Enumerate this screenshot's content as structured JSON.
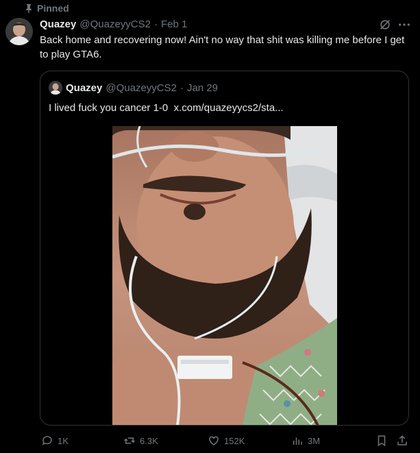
{
  "pinned": {
    "label": "Pinned"
  },
  "tweet": {
    "author_name": "Quazey",
    "handle": "@QuazeyyCS2",
    "separator": "·",
    "date": "Feb 1",
    "text": "Back home and recovering now! Ain't no way that shit was killing me before I get to play GTA6."
  },
  "quoted": {
    "author_name": "Quazey",
    "handle": "@QuazeyyCS2",
    "separator": "·",
    "date": "Jan 29",
    "text": "I lived fuck you cancer 1-0",
    "link": "x.com/quazeyycs2/sta..."
  },
  "actions": {
    "replies": "1K",
    "reposts": "6.3K",
    "likes": "152K",
    "views": "3M"
  },
  "icons": [
    "pin-icon",
    "grok-icon",
    "more-icon",
    "reply-icon",
    "repost-icon",
    "like-icon",
    "views-icon",
    "bookmark-icon",
    "share-icon"
  ],
  "colors": {
    "background": "#000000",
    "text": "#e7e9ea",
    "muted": "#71767b",
    "border": "#2f3336"
  }
}
